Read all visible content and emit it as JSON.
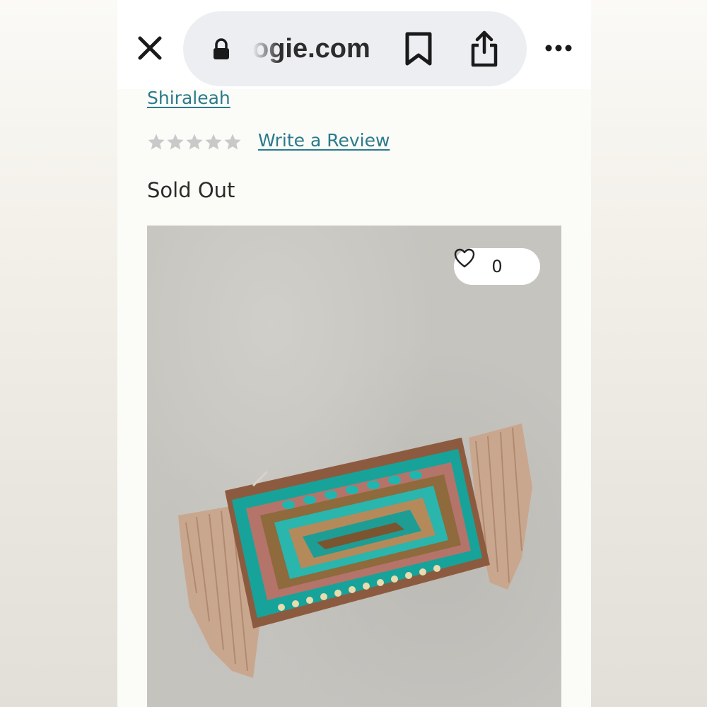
{
  "browser": {
    "url_visible": "ogie.com",
    "icons": [
      "close-icon",
      "lock-icon",
      "bookmark-icon",
      "share-icon",
      "more-icon"
    ]
  },
  "product": {
    "brand": "Shiraleah",
    "rating_stars": 0,
    "rating_max": 5,
    "review_link": "Write a Review",
    "status": "Sold Out",
    "like_count": "0"
  },
  "colors": {
    "link": "#2a7b8c",
    "star_empty": "#c9c9c9",
    "page_bg": "#fbfbf7",
    "url_pill": "#eceef1"
  }
}
